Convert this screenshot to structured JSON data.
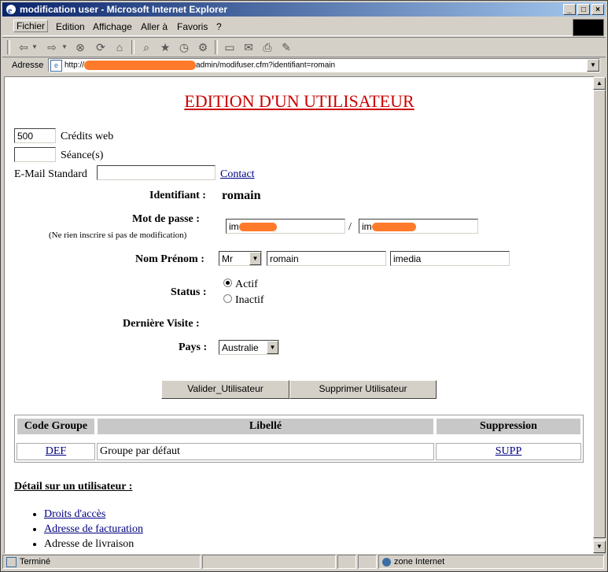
{
  "window": {
    "title": "modification user - Microsoft Internet Explorer"
  },
  "menu": [
    "Fichier",
    "Edition",
    "Affichage",
    "Aller à",
    "Favoris",
    "?"
  ],
  "address": {
    "label": "Adresse",
    "url_prefix": "http://",
    "url_suffix": "admin/modifuser.cfm?identifiant=romain"
  },
  "page": {
    "title": "EDITION D'UN UTILISATEUR",
    "credits_value": "500",
    "credits_label": "Crédits web",
    "seances_value": "",
    "seances_label": "Séance(s)",
    "email_label": "E-Mail Standard",
    "email_value": "",
    "contact_link": "Contact",
    "identifiant_label": "Identifiant :",
    "identifiant_value": "romain",
    "password_label": "Mot de passe :",
    "password_note": "(Ne rien inscrire si pas de modification)",
    "password_value1": "im",
    "password_sep": "/",
    "password_value2": "im",
    "nom_label": "Nom Prénom :",
    "civilite": "Mr",
    "prenom": "romain",
    "nom": "imedia",
    "status_label": "Status :",
    "status_actif": "Actif",
    "status_inactif": "Inactif",
    "derniere_visite_label": "Dernière Visite :",
    "pays_label": "Pays :",
    "pays_value": "Australie",
    "btn_valider": "Valider_Utilisateur",
    "btn_supprimer": "Supprimer Utilisateur",
    "table": {
      "headers": [
        "Code Groupe",
        "Libellé",
        "Suppression"
      ],
      "rows": [
        {
          "code": "DEF",
          "libelle": "Groupe par défaut",
          "suppression": "SUPP"
        }
      ]
    },
    "detail_heading": "Détail sur un utilisateur :",
    "detail_links": [
      "Droits d'accès",
      "Adresse de facturation",
      "Adresse de livraison"
    ]
  },
  "status": {
    "text": "Terminé",
    "zone": "zone Internet"
  }
}
